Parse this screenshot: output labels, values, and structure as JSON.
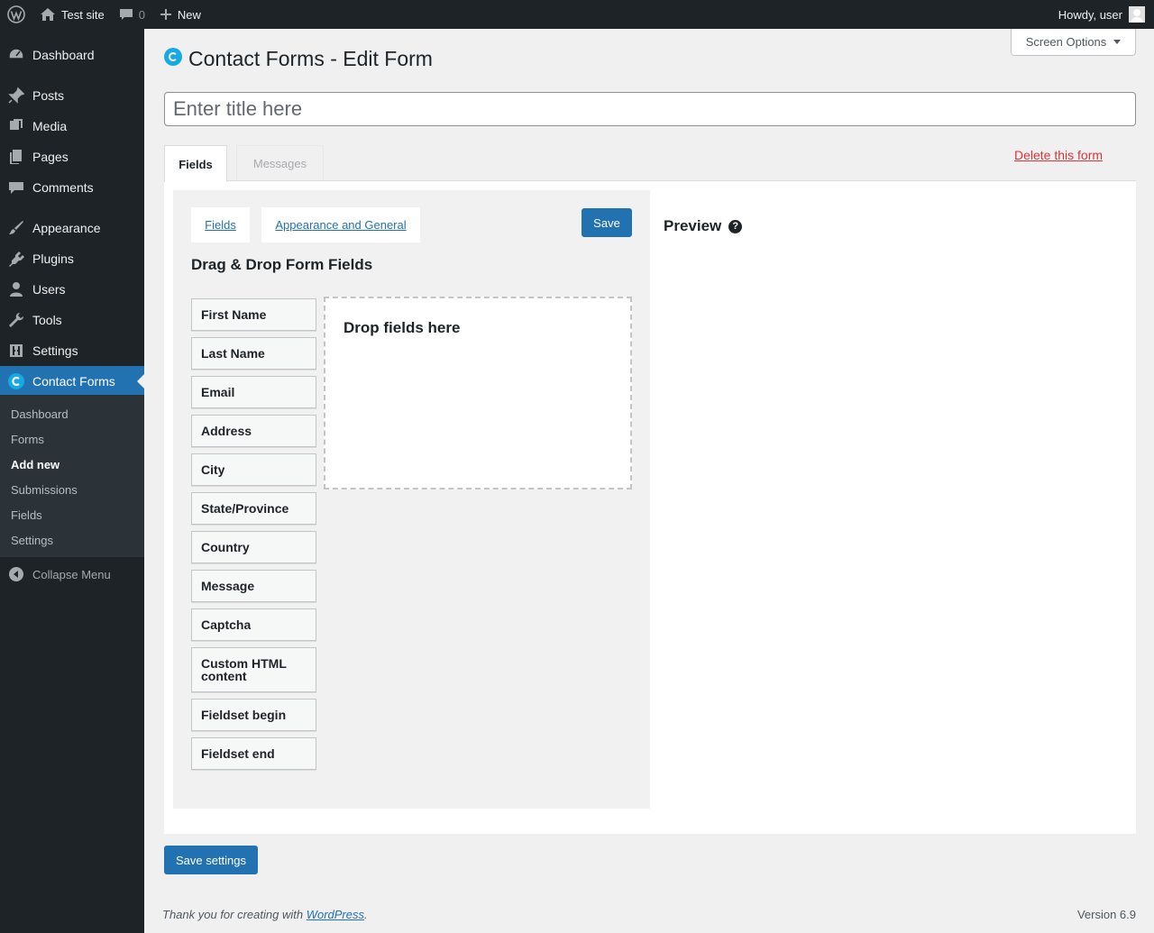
{
  "adminbar": {
    "site_name": "Test site",
    "comments_count": "0",
    "new_label": "New",
    "howdy": "Howdy, user"
  },
  "sidebar": {
    "items": [
      {
        "label": "Dashboard",
        "icon": "dashboard-icon"
      },
      {
        "label": "Posts",
        "icon": "pin-icon"
      },
      {
        "label": "Media",
        "icon": "media-icon"
      },
      {
        "label": "Pages",
        "icon": "pages-icon"
      },
      {
        "label": "Comments",
        "icon": "comment-icon"
      },
      {
        "label": "Appearance",
        "icon": "brush-icon"
      },
      {
        "label": "Plugins",
        "icon": "plugin-icon"
      },
      {
        "label": "Users",
        "icon": "user-icon"
      },
      {
        "label": "Tools",
        "icon": "wrench-icon"
      },
      {
        "label": "Settings",
        "icon": "settings-icon"
      },
      {
        "label": "Contact Forms",
        "icon": "contact-forms-icon"
      }
    ],
    "submenu": [
      "Dashboard",
      "Forms",
      "Add new",
      "Submissions",
      "Fields",
      "Settings"
    ],
    "collapse_label": "Collapse Menu"
  },
  "screen_options_label": "Screen Options",
  "page_title": "Contact Forms - Edit Form",
  "title_placeholder": "Enter title here",
  "tabs": {
    "fields": "Fields",
    "messages": "Messages"
  },
  "delete_label": "Delete this form",
  "builder": {
    "tab_fields": "Fields",
    "tab_appearance": "Appearance and General",
    "save_label": "Save",
    "title": "Drag & Drop Form Fields",
    "fields": [
      "First Name",
      "Last Name",
      "Email",
      "Address",
      "City",
      "State/Province",
      "Country",
      "Message",
      "Captcha",
      "Custom HTML content",
      "Fieldset begin",
      "Fieldset end"
    ],
    "dropzone_label": "Drop fields here"
  },
  "preview_title": "Preview",
  "save_settings_label": "Save settings",
  "footer": {
    "thanks_prefix": "Thank you for creating with ",
    "wordpress_link": "WordPress",
    "thanks_suffix": ".",
    "version": "Version 6.9"
  },
  "colors": {
    "accent": "#2271b1",
    "sidebar_bg": "#1d2327",
    "delete": "#d63638",
    "brand": "#17a9e1"
  }
}
